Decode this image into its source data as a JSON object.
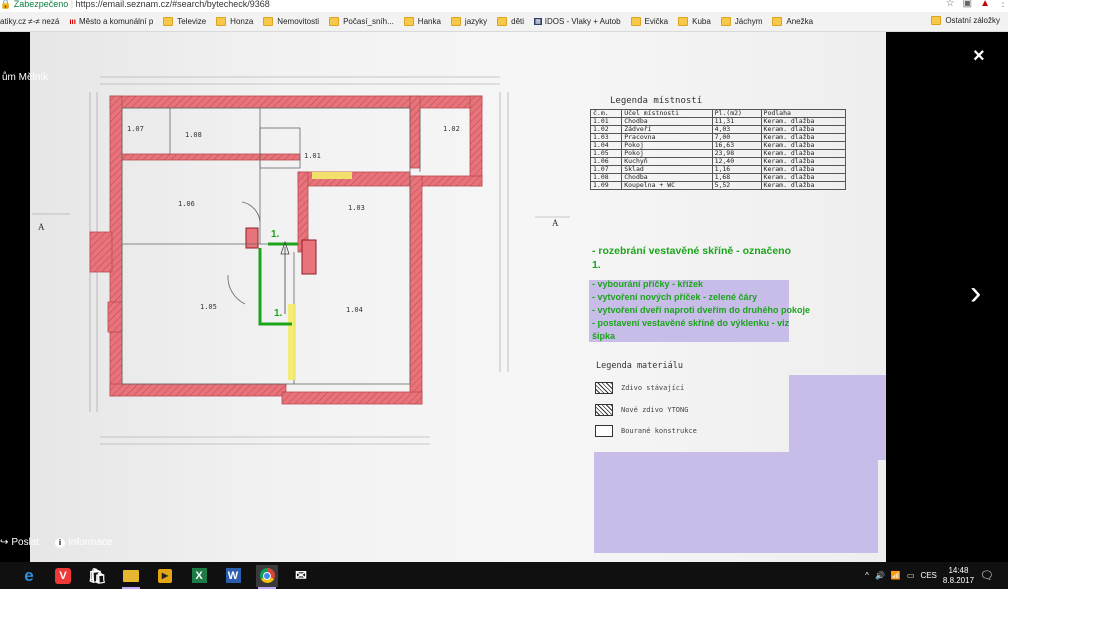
{
  "address_bar": {
    "security": "Zabezpečeno",
    "url": "https://email.seznam.cz/#search/bytecheck/9368"
  },
  "bookmarks": [
    "atiky.cz ≠-≠ nezá",
    "Město a komunální p",
    "Televize",
    "Honza",
    "Nemovitosti",
    "Počasí_sníh...",
    "Hanka",
    "jazyky",
    "děti",
    "IDOS - Vlaky + Autob",
    "Evička",
    "Kuba",
    "Jáchym",
    "Anežka"
  ],
  "bookmarks_other": "Ostatní záložky",
  "viewer": {
    "title": "ům Mělník",
    "close_icon": "×",
    "next_icon": "›",
    "send_label": "Poslat",
    "info_label": "Informace"
  },
  "plan": {
    "room_labels": [
      "1.07",
      "1.08",
      "1.02",
      "1.01",
      "1.06",
      "1.03",
      "1.05",
      "1.04"
    ],
    "markers": [
      "1.",
      "1."
    ],
    "section_marks": [
      "A",
      "A"
    ],
    "legend_title": "Legenda místností",
    "legend_header": [
      "č.m.",
      "Účel místnosti",
      "Pl.(m2)",
      "Podlaha"
    ],
    "legend_rows": [
      [
        "1.01",
        "Chodba",
        "11,31",
        "Keram. dlažba"
      ],
      [
        "1.02",
        "Zádveří",
        "4,03",
        "Keram. dlažba"
      ],
      [
        "1.03",
        "Pracovna",
        "7,00",
        "Keram. dlažba"
      ],
      [
        "1.04",
        "Pokoj",
        "16,63",
        "Keram. dlažba"
      ],
      [
        "1.05",
        "Pokoj",
        "23,98",
        "Keram. dlažba"
      ],
      [
        "1.06",
        "Kuchyň",
        "12,40",
        "Keram. dlažba"
      ],
      [
        "1.07",
        "Sklad",
        "1,16",
        "Keram. dlažba"
      ],
      [
        "1.08",
        "Chodba",
        "1,68",
        "Keram. dlažba"
      ],
      [
        "1.09",
        "Koupelna + WC",
        "5,52",
        "Keram. dlažba"
      ]
    ],
    "green_heading": "- rozebrání vestavěné skříně - označeno 1.",
    "notes": [
      "- vybourání příčky - křížek",
      "- vytvoření nových příček - zelené čáry",
      "- vytvoření dveří naproti dveřím do druhého pokoje",
      "- postavení vestavěné skříně do výklenku - viz šipka"
    ],
    "materials_title": "Legenda materiálu",
    "materials": [
      "Zdivo stávající",
      "Nové zdivo YTONG",
      "Bourané konstrukce"
    ]
  },
  "taskbar": {
    "icons": [
      "windows-logo",
      "edge",
      "vivaldi",
      "store",
      "explorer",
      "media",
      "excel",
      "word",
      "chrome",
      "mail"
    ],
    "tray": {
      "up_arrow": "^",
      "lang": "CES",
      "time": "14:48",
      "date": "8.8.2017"
    }
  },
  "colors": {
    "wall_red": "#e8737a",
    "lavender": "#c8bde8",
    "green": "#1aa51a",
    "yellow": "#f3ec6a"
  }
}
